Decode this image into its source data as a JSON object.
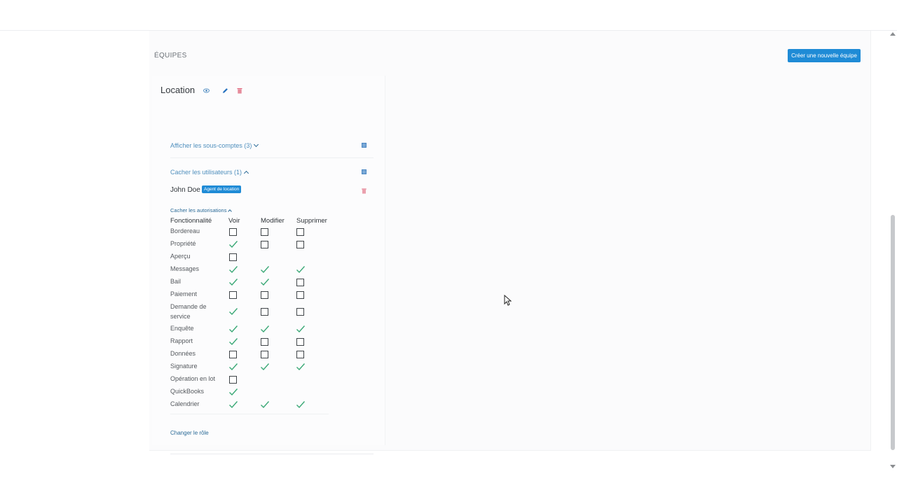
{
  "section": {
    "title": "ÉQUIPES",
    "create_button": "Créer une nouvelle équipe"
  },
  "team": {
    "name": "Location",
    "subaccounts_toggle": "Afficher les sous-comptes (3)",
    "users_toggle": "Cacher les utilisateurs (1)",
    "user": {
      "name": "John Doe",
      "role": "Agent de location"
    },
    "permissions_toggle": "Cacher les autorisations",
    "columns": [
      "Fonctionnalité",
      "Voir",
      "Modifier",
      "Supprimer"
    ],
    "permissions": [
      {
        "label": "Bordereau",
        "view": "unchecked",
        "edit": "unchecked",
        "delete": "unchecked"
      },
      {
        "label": "Propriété",
        "view": "checked",
        "edit": "unchecked",
        "delete": "unchecked"
      },
      {
        "label": "Aperçu",
        "view": "unchecked",
        "edit": "none",
        "delete": "none"
      },
      {
        "label": "Messages",
        "view": "checked",
        "edit": "checked",
        "delete": "checked"
      },
      {
        "label": "Bail",
        "view": "checked",
        "edit": "checked",
        "delete": "unchecked"
      },
      {
        "label": "Paiement",
        "view": "unchecked",
        "edit": "unchecked",
        "delete": "unchecked"
      },
      {
        "label": "Demande de service",
        "view": "checked",
        "edit": "unchecked",
        "delete": "unchecked"
      },
      {
        "label": "Enquête",
        "view": "checked",
        "edit": "checked",
        "delete": "checked"
      },
      {
        "label": "Rapport",
        "view": "checked",
        "edit": "unchecked",
        "delete": "unchecked"
      },
      {
        "label": "Données",
        "view": "unchecked",
        "edit": "unchecked",
        "delete": "unchecked"
      },
      {
        "label": "Signature",
        "view": "checked",
        "edit": "checked",
        "delete": "checked"
      },
      {
        "label": "Opération en lot",
        "view": "unchecked",
        "edit": "none",
        "delete": "none"
      },
      {
        "label": "QuickBooks",
        "view": "checked",
        "edit": "none",
        "delete": "none"
      },
      {
        "label": "Calendrier",
        "view": "checked",
        "edit": "checked",
        "delete": "checked"
      }
    ],
    "change_role": "Changer le rôle"
  },
  "icons": {
    "view": "eye-icon",
    "edit": "pencil-icon",
    "delete": "trash-icon",
    "check": "check-icon",
    "checkbox": "checkbox-empty-icon",
    "cursor": "mouse-pointer-icon"
  },
  "colors": {
    "accent": "#1f8bd6",
    "check": "#3aa876",
    "danger": "#e0647a",
    "link": "#2a6a97"
  }
}
